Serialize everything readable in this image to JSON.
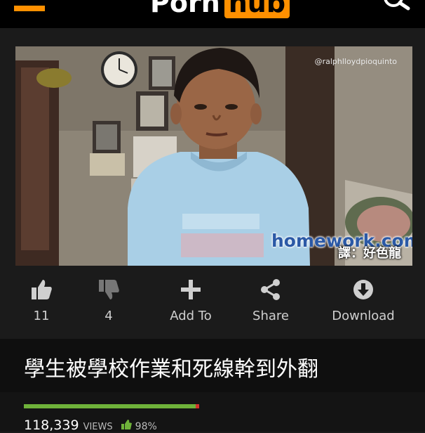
{
  "header": {
    "logo_part1": "Porn",
    "logo_part2": "hub"
  },
  "video": {
    "watermark": "@ralphlloydpioquinto",
    "overlay_logo": "homework.com",
    "translator": "譯：好色龍"
  },
  "actions": [
    {
      "label": "11",
      "icon": "thumbs-up-icon"
    },
    {
      "label": "4",
      "icon": "thumbs-down-icon"
    },
    {
      "label": "Add To",
      "icon": "plus-icon"
    },
    {
      "label": "Share",
      "icon": "share-icon"
    },
    {
      "label": "Download",
      "icon": "download-icon"
    }
  ],
  "title": "學生被學校作業和死線幹到外翻",
  "stats": {
    "views": "118,339",
    "views_label": "VIEWS",
    "rating": "98%",
    "rating_fraction": 0.98
  },
  "colors": {
    "brand": "#ff9000",
    "positive": "#6fb23a",
    "negative": "#d0342c"
  }
}
